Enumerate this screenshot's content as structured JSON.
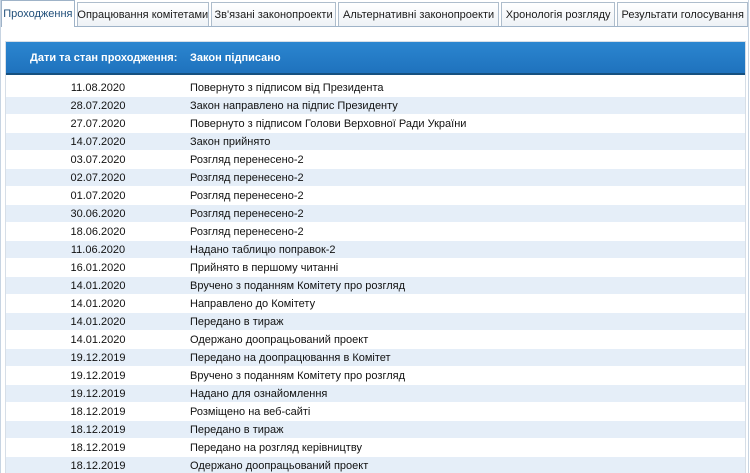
{
  "tabs": [
    {
      "label": "Проходження",
      "active": true
    },
    {
      "label": "Опрацювання комітетами",
      "active": false
    },
    {
      "label": "Зв'язані законопроекти",
      "active": false
    },
    {
      "label": "Альтернативні законопроекти",
      "active": false
    },
    {
      "label": "Хронологія розгляду",
      "active": false
    },
    {
      "label": "Результати голосування",
      "active": false
    }
  ],
  "header": {
    "label": "Дати та стан проходження:",
    "status": "Закон підписано"
  },
  "rows": [
    {
      "date": "11.08.2020",
      "event": "Повернуто з підписом від Президента"
    },
    {
      "date": "28.07.2020",
      "event": "Закон направлено на підпис Президенту"
    },
    {
      "date": "27.07.2020",
      "event": "Повернуто з підписом Голови Верховної Ради України"
    },
    {
      "date": "14.07.2020",
      "event": "Закон прийнято"
    },
    {
      "date": "03.07.2020",
      "event": "Розгляд перенесено-2"
    },
    {
      "date": "02.07.2020",
      "event": "Розгляд перенесено-2"
    },
    {
      "date": "01.07.2020",
      "event": "Розгляд перенесено-2"
    },
    {
      "date": "30.06.2020",
      "event": "Розгляд перенесено-2"
    },
    {
      "date": "18.06.2020",
      "event": "Розгляд перенесено-2"
    },
    {
      "date": "11.06.2020",
      "event": "Надано таблицю поправок-2"
    },
    {
      "date": "16.01.2020",
      "event": "Прийнято в першому читанні"
    },
    {
      "date": "14.01.2020",
      "event": "Вручено з поданням Комітету про розгляд"
    },
    {
      "date": "14.01.2020",
      "event": "Направлено до Комітету"
    },
    {
      "date": "14.01.2020",
      "event": "Передано в тираж"
    },
    {
      "date": "14.01.2020",
      "event": "Одержано доопрацьований проект"
    },
    {
      "date": "19.12.2019",
      "event": "Передано на доопрацювання в Комітет"
    },
    {
      "date": "19.12.2019",
      "event": "Вручено з поданням Комітету про розгляд"
    },
    {
      "date": "19.12.2019",
      "event": "Надано для ознайомлення"
    },
    {
      "date": "18.12.2019",
      "event": "Розміщено на веб-сайті"
    },
    {
      "date": "18.12.2019",
      "event": "Передано в тираж"
    },
    {
      "date": "18.12.2019",
      "event": "Передано на розгляд керівництву"
    },
    {
      "date": "18.12.2019",
      "event": "Одержано доопрацьований проект"
    }
  ]
}
